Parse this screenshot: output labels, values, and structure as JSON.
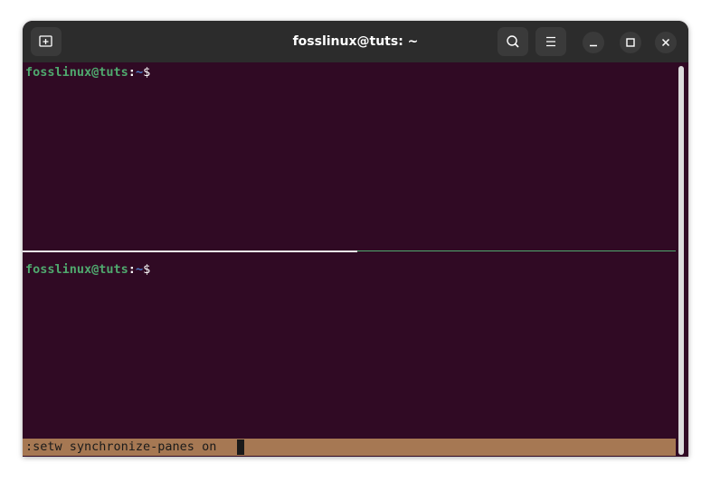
{
  "window": {
    "title": "fosslinux@tuts: ~",
    "colors": {
      "terminal_bg": "#300a24",
      "titlebar_bg": "#2c2c2c",
      "prompt_green": "#4fa96e",
      "path_blue": "#4d7bc4",
      "statusbar_bg": "#a67853"
    }
  },
  "titlebar": {
    "new_tab_icon": "new-tab-icon",
    "search_icon": "search-icon",
    "menu_icon": "hamburger-menu-icon",
    "minimize_icon": "minimize-icon",
    "maximize_icon": "maximize-icon",
    "close_icon": "close-icon"
  },
  "panes": [
    {
      "user_host": "fosslinux@tuts",
      "sep": ":",
      "path": "~",
      "symbol": "$"
    },
    {
      "user_host": "fosslinux@tuts",
      "sep": ":",
      "path": "~",
      "symbol": "$"
    }
  ],
  "statusbar": {
    "command": ":setw synchronize-panes on"
  }
}
